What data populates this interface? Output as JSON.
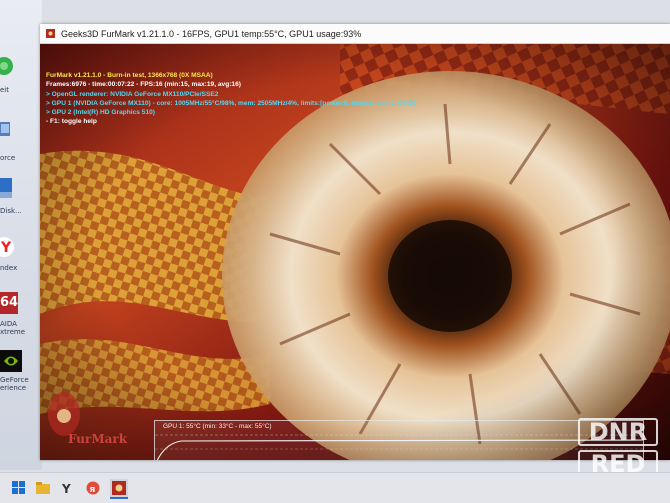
{
  "window": {
    "title": "Geeks3D FurMark v1.21.1.0 - 16FPS, GPU1 temp:55°C, GPU1 usage:93%"
  },
  "overlay": {
    "lines": [
      "FurMark v1.21.1.0 - Burn-in test, 1366x768 (0X MSAA)",
      "Frames:6976 - time:00:07:22 - FPS:16 (min:15, max:19, avg:16)",
      "> OpenGL renderer: NVIDIA GeForce MX110/PCIe/SSE2",
      "> GPU 1 (NVIDIA GeForce MX110) - core: 1005MHz/55°C/98%, mem: 2505MHz/4%, limits:[power:0, temp:0, volt:0, OV:0]",
      "> GPU 2 (Intel(R) HD Graphics 510)",
      "- F1: toggle help"
    ]
  },
  "graph": {
    "label": "GPU 1: 55°C (min: 33°C - max: 55°C)"
  },
  "logo": {
    "text": "FurMark"
  },
  "desktop_icons": [
    {
      "label": "eit",
      "icon": "green-globe-icon"
    },
    {
      "label": "orce",
      "icon": "computer-icon"
    },
    {
      "label": "Disk...",
      "icon": "disk-utility-icon"
    },
    {
      "label": "ndex",
      "icon": "yandex-browser-icon"
    },
    {
      "label": "64",
      "icon": "aida64-icon"
    },
    {
      "label": "AIDA\nxtreme",
      "icon": "aida64-label"
    },
    {
      "label": "GeForce\nerience",
      "icon": "nvidia-geforce-icon"
    }
  ],
  "taskbar": {
    "items": [
      "windows-start-icon",
      "file-explorer-icon",
      "yandex-icon",
      "yandex-music-icon",
      "furmark-taskbar-icon"
    ]
  },
  "watermark": {
    "line1": "DNR",
    "line2": "RED"
  },
  "colors": {
    "overlay_title": "#f6e94a",
    "overlay_info": "#52d8f3",
    "fur_base": "#e8d8c0",
    "fur_center": "#1a0c06"
  }
}
